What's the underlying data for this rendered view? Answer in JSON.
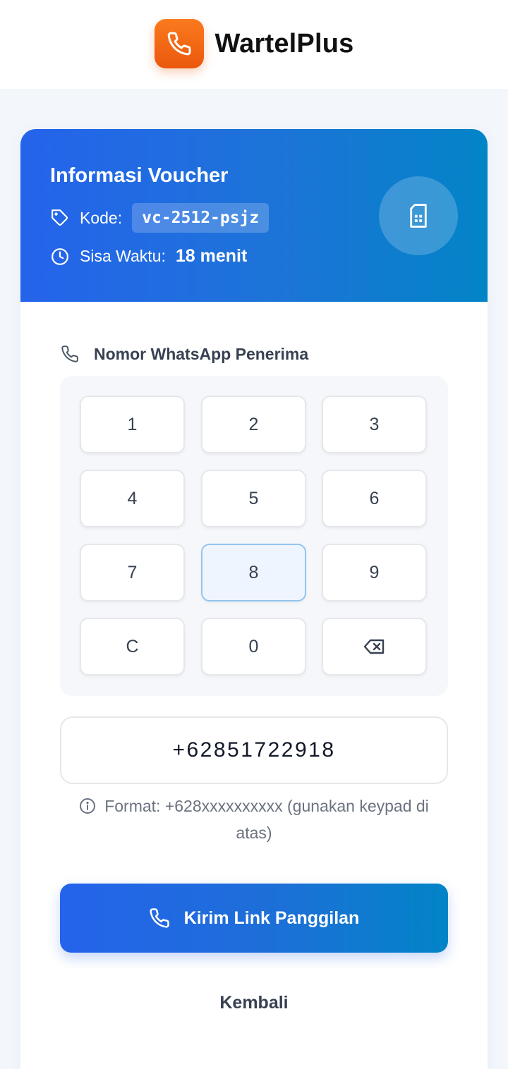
{
  "brand": {
    "name": "WartelPlus",
    "logo_icon": "phone-icon",
    "logo_color": "#f97316"
  },
  "voucher": {
    "title": "Informasi Voucher",
    "code_label": "Kode:",
    "code_value": "vc-2512-psjz",
    "time_label": "Sisa Waktu:",
    "time_value": "18 menit",
    "header_color_start": "#2563eb",
    "header_color_end": "#0284c7"
  },
  "phone_field": {
    "label": "Nomor WhatsApp Penerima",
    "value": "+62851722918"
  },
  "keypad": {
    "keys": [
      "1",
      "2",
      "3",
      "4",
      "5",
      "6",
      "7",
      "8",
      "9",
      "C",
      "0",
      "backspace"
    ],
    "active_key": "8"
  },
  "hint": {
    "text": "Format: +628xxxxxxxxxx (gunakan keypad di atas)"
  },
  "actions": {
    "send_label": "Kirim Link Panggilan",
    "back_label": "Kembali"
  }
}
